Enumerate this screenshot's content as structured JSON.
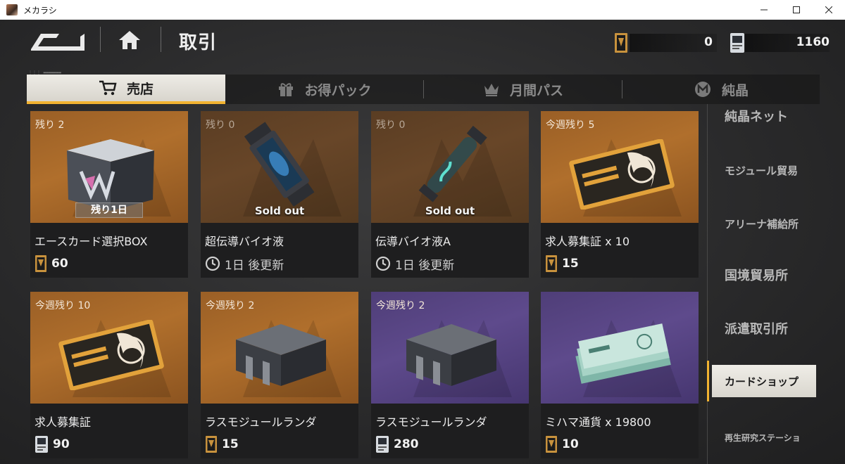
{
  "window": {
    "title": "メカラシ"
  },
  "header": {
    "page_title": "取引"
  },
  "currencies": [
    {
      "icon": "card-voucher-icon",
      "amount": "0"
    },
    {
      "icon": "data-chip-icon",
      "amount": "1160"
    }
  ],
  "tabs": [
    {
      "label": "売店",
      "icon": "cart-icon",
      "active": true
    },
    {
      "label": "お得パック",
      "icon": "gift-icon",
      "active": false
    },
    {
      "label": "月間パス",
      "icon": "crown-icon",
      "active": false
    },
    {
      "label": "純晶",
      "icon": "crystal-coin-icon",
      "active": false
    }
  ],
  "sidebar": {
    "items": [
      {
        "label": "純晶ネット",
        "active": false
      },
      {
        "label": "モジュール貿易",
        "active": false
      },
      {
        "label": "アリーナ補給所",
        "active": false
      },
      {
        "label": "国境貿易所",
        "active": false
      },
      {
        "label": "派遣取引所",
        "active": false
      },
      {
        "label": "カードショップ",
        "active": true
      },
      {
        "label": "再生研究ステーショ",
        "active": false
      }
    ]
  },
  "items": [
    {
      "stock": "残り 2",
      "name": "エースカード選択BOX",
      "price": "60",
      "currency_icon": "card-voucher-icon",
      "banner": "残り1日",
      "art": "ace-box-icon",
      "theme": "#a8682a"
    },
    {
      "stock": "残り 0",
      "name": "超伝導バイオ液",
      "refresh": "1日 後更新",
      "sold_out": "Sold out",
      "art": "bio-canister-icon",
      "theme": "#5f4226"
    },
    {
      "stock": "残り 0",
      "name": "伝導バイオ液A",
      "refresh": "1日 後更新",
      "sold_out": "Sold out",
      "art": "bio-tube-icon",
      "theme": "#5f4226"
    },
    {
      "stock": "今週残り 5",
      "name": "求人募集証 x 10",
      "price": "15",
      "currency_icon": "card-voucher-icon",
      "art": "recruit-voucher-icon",
      "theme": "#a8682a"
    },
    {
      "stock": "今週残り 10",
      "name": "求人募集証",
      "price": "90",
      "currency_icon": "data-chip-icon",
      "art": "recruit-voucher-icon",
      "theme": "#a8682a"
    },
    {
      "stock": "今週残り 2",
      "name": "ラスモジュールランダ",
      "price": "15",
      "currency_icon": "card-voucher-icon",
      "art": "module-crate-icon",
      "theme": "#a8682a"
    },
    {
      "stock": "今週残り 2",
      "name": "ラスモジュールランダ",
      "price": "280",
      "currency_icon": "data-chip-icon",
      "art": "module-crate-icon",
      "theme": "#5a4686"
    },
    {
      "stock": "",
      "name": "ミハマ通貨 x 19800",
      "price": "10",
      "currency_icon": "card-voucher-icon",
      "art": "cash-stack-icon",
      "theme": "#5a4686"
    }
  ],
  "colors": {
    "accent": "#f2b331",
    "card_orange": "#a8682a",
    "card_purple": "#5a4686"
  }
}
